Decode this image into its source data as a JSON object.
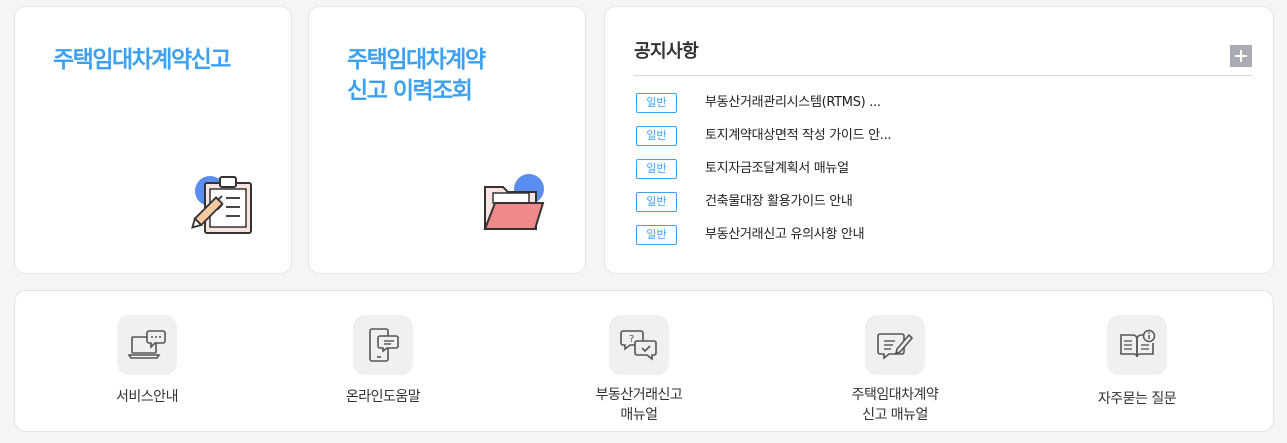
{
  "cards": {
    "contract_report": {
      "title": "주택임대차계약신고"
    },
    "report_history": {
      "title_line1": "주택임대차계약",
      "title_line2": "신고 이력조회"
    }
  },
  "notice": {
    "title": "공지사항",
    "more_icon": "plus-icon",
    "items": [
      {
        "badge": "일반",
        "text": "부동산거래관리시스템(RTMS) ..."
      },
      {
        "badge": "일반",
        "text": "토지계약대상면적 작성 가이드 안..."
      },
      {
        "badge": "일반",
        "text": "토지자금조달계획서 매뉴얼"
      },
      {
        "badge": "일반",
        "text": "건축물대장 활용가이드 안내"
      },
      {
        "badge": "일반",
        "text": "부동산거래신고 유의사항 안내"
      }
    ]
  },
  "services": [
    {
      "icon": "laptop-chat-icon",
      "label": "서비스안내"
    },
    {
      "icon": "mobile-chat-icon",
      "label": "온라인도움말"
    },
    {
      "icon": "question-chat-icon",
      "label": "부동산거래신고\n매뉴얼"
    },
    {
      "icon": "pen-note-icon",
      "label": "주택임대차계약\n신고 매뉴얼"
    },
    {
      "icon": "book-info-icon",
      "label": "자주묻는 질문"
    }
  ],
  "colors": {
    "accent": "#3da1f2",
    "icon_blue": "#5b8def",
    "icon_red": "#f08a8a"
  }
}
